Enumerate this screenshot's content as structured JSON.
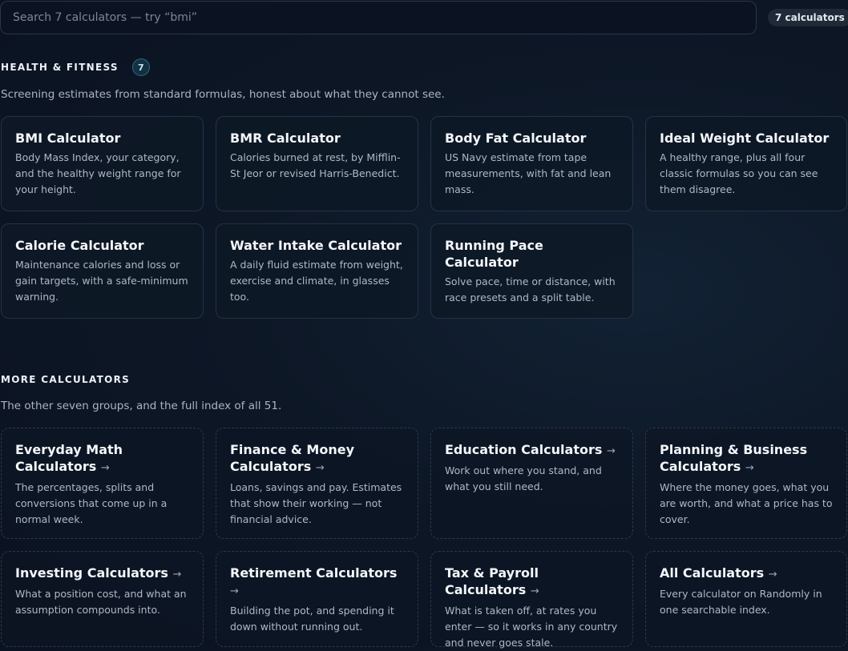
{
  "search": {
    "placeholder": "Search 7 calculators — try “bmi”",
    "value": ""
  },
  "count_pill": "7 calculators",
  "health_section": {
    "title": "HEALTH & FITNESS",
    "badge": "7",
    "description": "Screening estimates from standard formulas, honest about what they cannot see.",
    "cards": [
      {
        "title": "BMI Calculator",
        "description": "Body Mass Index, your category, and the healthy weight range for your height."
      },
      {
        "title": "BMR Calculator",
        "description": "Calories burned at rest, by Mifflin-St Jeor or revised Harris-Benedict."
      },
      {
        "title": "Body Fat Calculator",
        "description": "US Navy estimate from tape measurements, with fat and lean mass."
      },
      {
        "title": "Ideal Weight Calculator",
        "description": "A healthy range, plus all four classic formulas so you can see them disagree."
      },
      {
        "title": "Calorie Calculator",
        "description": "Maintenance calories and loss or gain targets, with a safe-minimum warning."
      },
      {
        "title": "Water Intake Calculator",
        "description": "A daily fluid estimate from weight, exercise and climate, in glasses too."
      },
      {
        "title": "Running Pace Calculator",
        "description": "Solve pace, time or distance, with race presets and a split table."
      }
    ]
  },
  "more_section": {
    "title": "MORE CALCULATORS",
    "description": "The other seven groups, and the full index of all 51.",
    "arrow": "→",
    "cards": [
      {
        "title": "Everyday Math Calculators",
        "description": "The percentages, splits and conversions that come up in a normal week."
      },
      {
        "title": "Finance & Money Calculators",
        "description": "Loans, savings and pay. Estimates that show their working — not financial advice."
      },
      {
        "title": "Education Calculators",
        "description": "Work out where you stand, and what you still need."
      },
      {
        "title": "Planning & Business Calculators",
        "description": "Where the money goes, what you are worth, and what a price has to cover."
      },
      {
        "title": "Investing Calculators",
        "description": "What a position cost, and what an assumption compounds into."
      },
      {
        "title": "Retirement Calculators",
        "description": "Building the pot, and spending it down without running out."
      },
      {
        "title": "Tax & Payroll Calculators",
        "description": "What is taken off, at rates you enter — so it works in any country and never goes stale."
      },
      {
        "title": "All Calculators",
        "description": "Every calculator on Randomly in one searchable index."
      }
    ]
  }
}
